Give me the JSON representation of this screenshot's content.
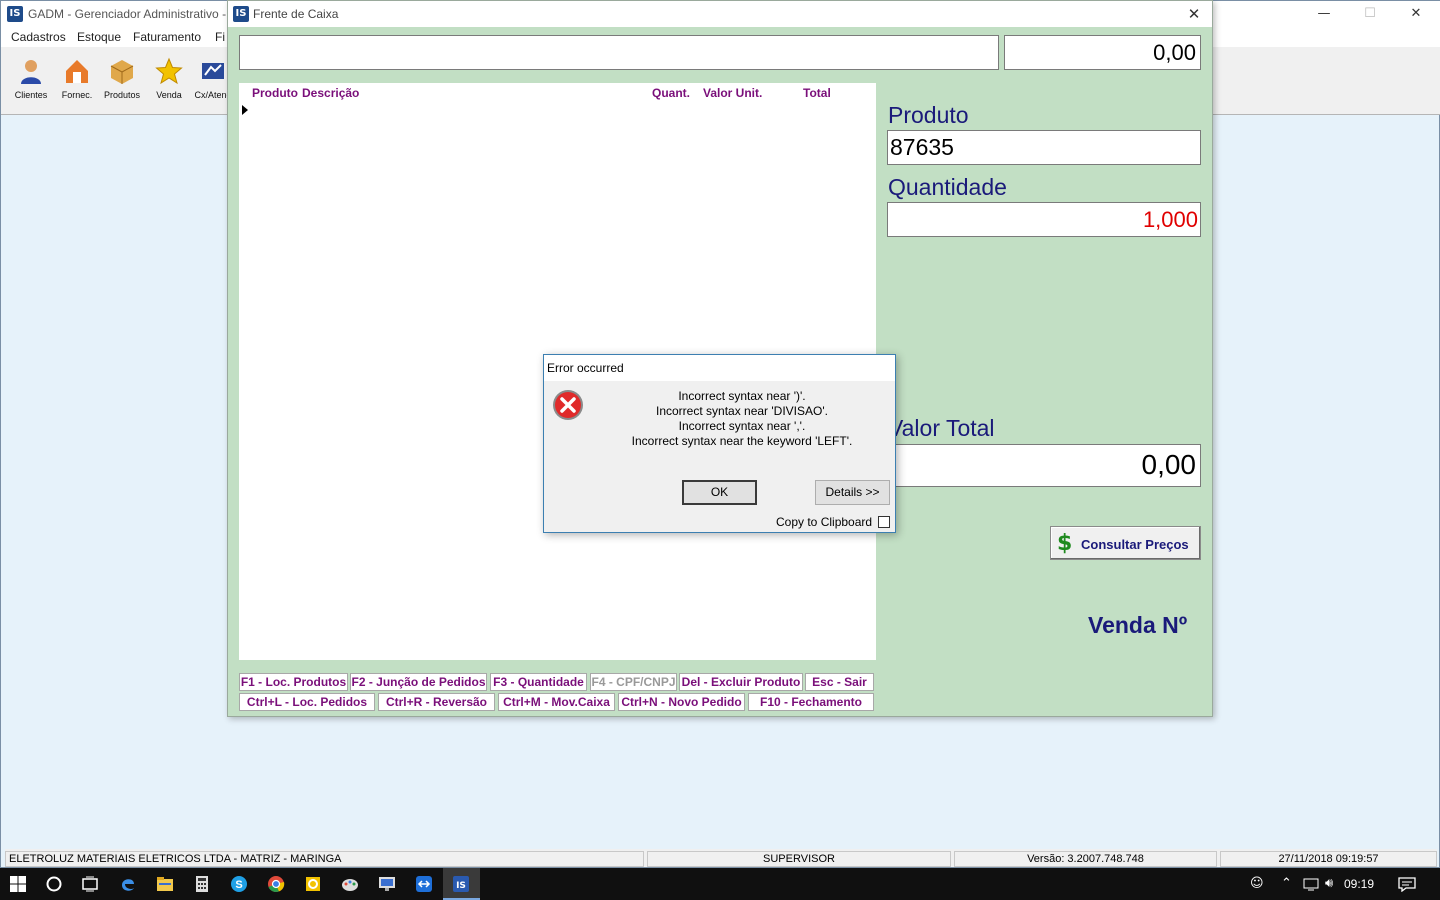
{
  "main_window": {
    "title": "GADM - Gerenciador Administrativo -",
    "menu": [
      "Cadastros",
      "Estoque",
      "Faturamento",
      "Fi"
    ],
    "toolbar": [
      {
        "label": "Clientes",
        "icon": "person-icon"
      },
      {
        "label": "Fornec.",
        "icon": "supplier-icon"
      },
      {
        "label": "Produtos",
        "icon": "box-icon"
      },
      {
        "label": "Venda",
        "icon": "star-icon"
      },
      {
        "label": "Cx/Atend",
        "icon": "register-icon"
      }
    ],
    "status": {
      "company": "ELETROLUZ MATERIAIS ELETRICOS LTDA  -  MATRIZ - MARINGA",
      "user": "SUPERVISOR",
      "version": "Versão: 3.2007.748.748",
      "datetime": "27/11/2018 09:19:57"
    }
  },
  "caixa": {
    "title": "Frente de Caixa",
    "top_search_value": "",
    "top_total": "0,00",
    "grid_headers": {
      "produto": "Produto",
      "descricao": "Descrição",
      "quant": "Quant.",
      "valor_unit": "Valor Unit.",
      "total": "Total"
    },
    "produto_label": "Produto",
    "produto_value": "87635",
    "quantidade_label": "Quantidade",
    "quantidade_value": "1,000",
    "valor_total_label": "Valor Total",
    "valor_total_value": "0,00",
    "consultar_label": "Consultar Preços",
    "venda_label": "Venda Nº",
    "fkeys_row1": [
      "F1 - Loc. Produtos",
      "F2 - Junção de Pedidos",
      "F3 - Quantidade",
      "F4 - CPF/CNPJ",
      "Del - Excluir Produto",
      "Esc - Sair"
    ],
    "fkeys_row2": [
      "Ctrl+L - Loc. Pedidos",
      "Ctrl+R - Reversão",
      "Ctrl+M - Mov.Caixa",
      "Ctrl+N - Novo Pedido",
      "F10 - Fechamento"
    ]
  },
  "error_dialog": {
    "title": "Error occurred",
    "lines": [
      "Incorrect syntax near ')'.",
      "Incorrect syntax near 'DIVISAO'.",
      "Incorrect syntax near ','.",
      "Incorrect syntax near the keyword 'LEFT'."
    ],
    "ok_label": "OK",
    "details_label": "Details >>",
    "copy_label": "Copy to Clipboard"
  },
  "taskbar": {
    "clock": "09:19"
  },
  "colors": {
    "caixa_bg": "#c2dfc4",
    "grid_header": "#7a0f7a",
    "label_navy": "#1a1a7a",
    "quantity_red": "#e00000"
  }
}
